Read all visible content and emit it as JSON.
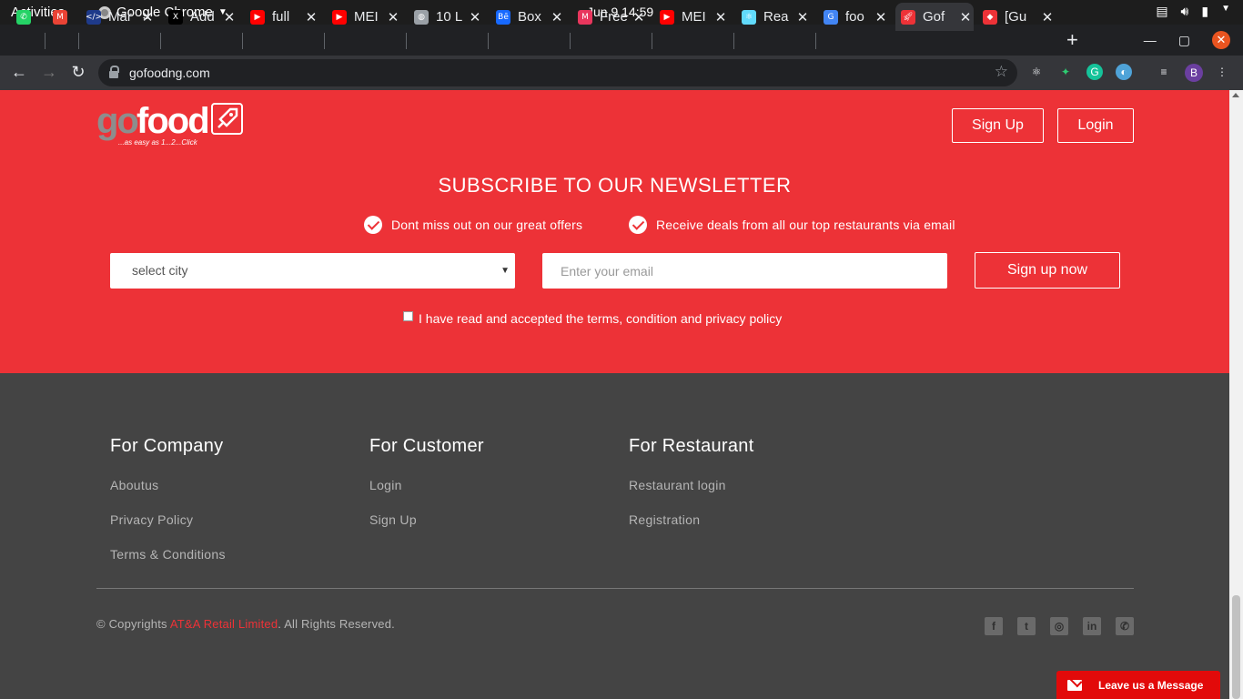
{
  "os": {
    "activities": "Activities",
    "app_name": "Google Chrome",
    "clock": "Jun 9  14:59"
  },
  "browser": {
    "tabs": [
      {
        "label": "",
        "icon": "whatsapp-icon",
        "color": "#25d366"
      },
      {
        "label": "",
        "icon": "gmail-icon",
        "color": "#ea4335"
      },
      {
        "label": "Mar",
        "icon": "code-icon",
        "color": "#1e3a8a"
      },
      {
        "label": "Add",
        "icon": "x-logo-icon",
        "color": "#000000"
      },
      {
        "label": "full",
        "icon": "youtube-icon",
        "color": "#ff0000"
      },
      {
        "label": "MEI",
        "icon": "youtube-icon",
        "color": "#ff0000"
      },
      {
        "label": "10 L",
        "icon": "globe-icon",
        "color": "#9aa0a6"
      },
      {
        "label": "Box",
        "icon": "behance-icon",
        "color": "#1769ff"
      },
      {
        "label": "Free",
        "icon": "mail-icon",
        "color": "#e8365d"
      },
      {
        "label": "MEI",
        "icon": "youtube-icon",
        "color": "#ff0000"
      },
      {
        "label": "Rea",
        "icon": "react-icon",
        "color": "#61dafb"
      },
      {
        "label": "foo",
        "icon": "google-icon",
        "color": "#4285f4"
      },
      {
        "label": "Gof",
        "icon": "gofood-icon",
        "color": "#ed3237"
      },
      {
        "label": "[Gu",
        "icon": "app-icon",
        "color": "#ed3237"
      }
    ],
    "url": "gofoodng.com",
    "profile_initial": "B"
  },
  "header": {
    "logo_go": "go",
    "logo_food": "food",
    "logo_tagline": "...as easy as 1...2...Click",
    "signup_label": "Sign Up",
    "login_label": "Login"
  },
  "newsletter": {
    "title": "SUBSCRIBE TO OUR NEWSLETTER",
    "perk1": "Dont miss out on our great offers",
    "perk2": "Receive deals from all our top restaurants via email",
    "city_selected": "select city",
    "email_placeholder": "Enter your email",
    "submit_label": "Sign up now",
    "terms_label": "I have read and accepted the terms, condition and privacy policy"
  },
  "footer": {
    "company": {
      "title": "For Company",
      "links": [
        "Aboutus",
        "Privacy Policy",
        "Terms & Conditions"
      ]
    },
    "customer": {
      "title": "For Customer",
      "links": [
        "Login",
        "Sign Up"
      ]
    },
    "restaurant": {
      "title": "For Restaurant",
      "links": [
        "Restaurant login",
        "Registration"
      ]
    },
    "copy_prefix": "© Copyrights ",
    "copy_company": "AT&A Retail Limited",
    "copy_suffix": ". All Rights Reserved.",
    "social": [
      "facebook-icon",
      "twitter-icon",
      "instagram-icon",
      "linkedin-icon",
      "whatsapp-icon"
    ]
  },
  "chat": {
    "label": "Leave us a Message"
  },
  "colors": {
    "brand_red": "#ed3237",
    "footer_bg": "#444444",
    "chat_red": "#e20a0a"
  }
}
